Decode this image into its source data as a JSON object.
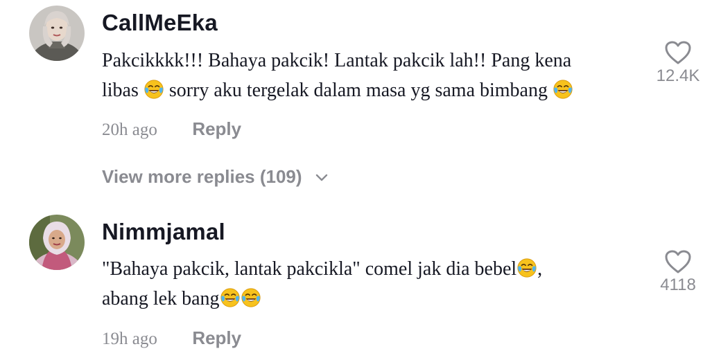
{
  "comments": [
    {
      "username": "CallMeEka",
      "text_line1": "Pakcikkkk!!! Bahaya pakcik! Lantak pakcik lah!! Pang kena",
      "text_line2a": "libas",
      "text_line2b": "sorry aku tergelak dalam masa yg sama bimbang",
      "time": "20h ago",
      "reply_label": "Reply",
      "likes": "12.4K",
      "emoji": "face-with-tears-of-joy"
    },
    {
      "username": "Nimmjamal",
      "text_line1": "\"Bahaya pakcik, lantak pakcikla\" comel jak dia bebel",
      "text_line1_tail": ",",
      "text_line2": "abang lek bang",
      "time": "19h ago",
      "reply_label": "Reply",
      "likes": "4118",
      "emoji": "face-with-tears-of-joy"
    }
  ],
  "view_more": {
    "label": "View more replies (109)"
  },
  "icons": {
    "like": "heart-outline-icon",
    "expand": "chevron-down-icon"
  },
  "colors": {
    "text": "#161823",
    "muted": "#8a8b91",
    "emoji": "#f7c21d"
  }
}
